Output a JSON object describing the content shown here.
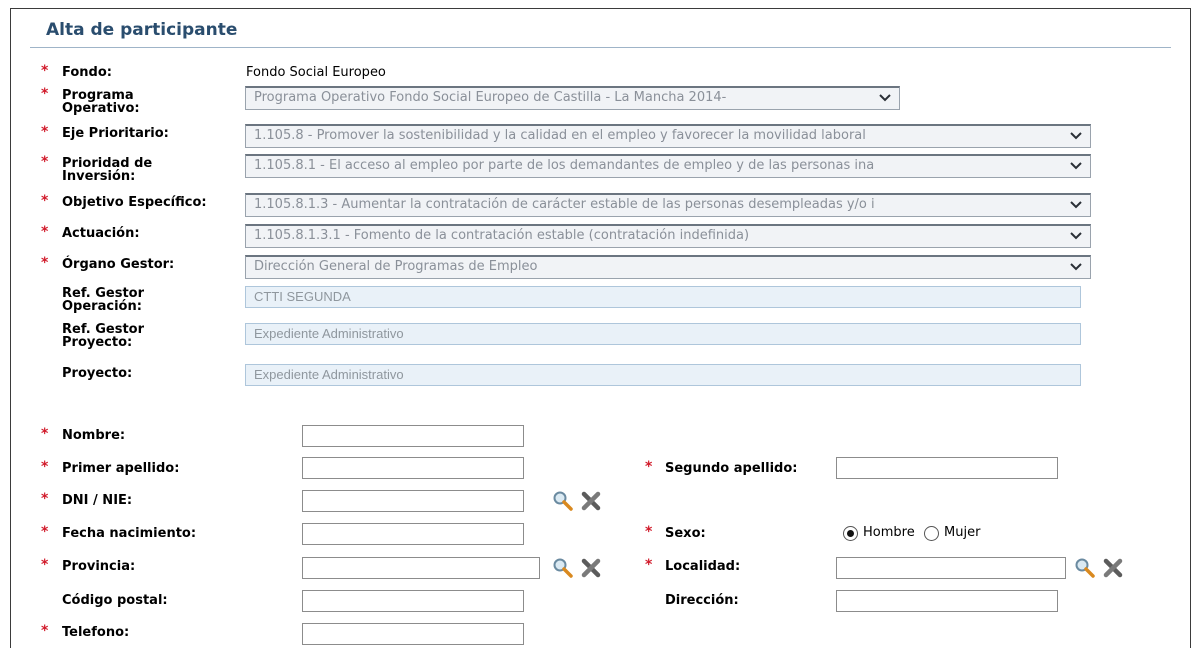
{
  "title": "Alta de participante",
  "fondo": {
    "label": "Fondo:",
    "value": "Fondo Social Europeo"
  },
  "programa": {
    "label": "Programa Operativo:",
    "value": "Programa Operativo Fondo Social Europeo de Castilla - La Mancha 2014-"
  },
  "eje": {
    "label": "Eje Prioritario:",
    "value": "1.105.8 - Promover la sostenibilidad y la calidad en el empleo y favorecer la movilidad laboral"
  },
  "prioridad": {
    "label": "Prioridad de Inversión:",
    "value": "1.105.8.1 - El acceso al empleo por parte de los demandantes de empleo y de las personas ina"
  },
  "objetivo": {
    "label": "Objetivo Específico:",
    "value": "1.105.8.1.3 - Aumentar la contratación de carácter estable de las personas desempleadas y/o i"
  },
  "actuacion": {
    "label": "Actuación:",
    "value": "1.105.8.1.3.1 - Fomento de la contratación estable (contratación indefinida)"
  },
  "organo": {
    "label": "Órgano Gestor:",
    "value": "Dirección General de Programas de Empleo"
  },
  "ref_operacion": {
    "label": "Ref. Gestor Operación:",
    "value": "CTTI SEGUNDA"
  },
  "ref_proyecto": {
    "label": "Ref. Gestor Proyecto:",
    "value": "Expediente Administrativo"
  },
  "proyecto": {
    "label": "Proyecto:",
    "value": "Expediente Administrativo"
  },
  "personal": {
    "nombre": "Nombre:",
    "primer_apellido": "Primer apellido:",
    "segundo_apellido": "Segundo apellido:",
    "dni": "DNI / NIE:",
    "fecha_nacimiento": "Fecha nacimiento:",
    "sexo": "Sexo:",
    "sexo_options": [
      "Hombre",
      "Mujer"
    ],
    "sexo_selected": "Hombre",
    "provincia": "Provincia:",
    "localidad": "Localidad:",
    "codigo_postal": "Código postal:",
    "direccion": "Dirección:",
    "telefono": "Telefono:"
  },
  "required_mark": "*",
  "colors": {
    "title": "#2a4d6e",
    "required": "#d11a2a",
    "readonly_bg": "#e9f1f8",
    "select_bg": "#f1f3f6"
  }
}
